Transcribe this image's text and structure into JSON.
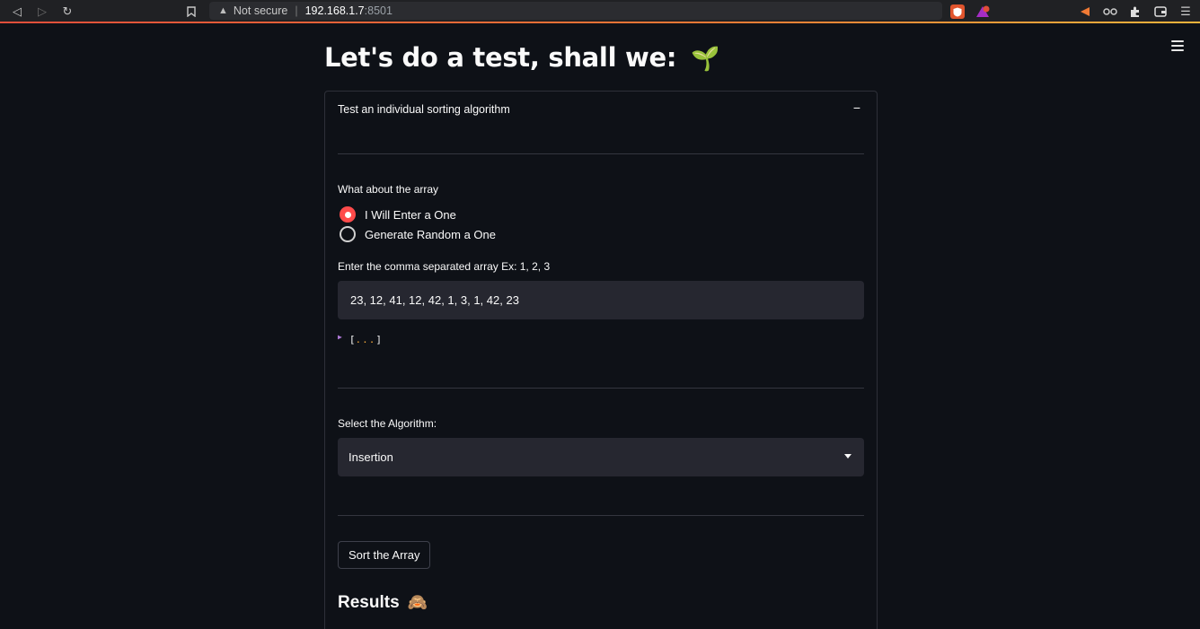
{
  "browser": {
    "security_label": "Not secure",
    "host": "192.168.1.7",
    "port": ":8501"
  },
  "page": {
    "title": "Let's do a test, shall we:",
    "title_emoji": "🌱"
  },
  "expander": {
    "header": "Test an individual sorting algorithm",
    "toggle": "−"
  },
  "array_section": {
    "label": "What about the array",
    "options": [
      {
        "label": "I Will Enter a One",
        "selected": true
      },
      {
        "label": "Generate Random a One",
        "selected": false
      }
    ],
    "input_label": "Enter the comma separated array Ex: 1, 2, 3",
    "input_value": "23, 12, 41, 12, 42, 1, 3, 1, 42, 23",
    "json_open": "[",
    "json_dots": "...",
    "json_close": "]"
  },
  "algorithm_section": {
    "label": "Select the Algorithm:",
    "selected": "Insertion"
  },
  "actions": {
    "sort_button": "Sort the Array"
  },
  "results": {
    "heading": "Results",
    "emoji": "🙈"
  },
  "colors": {
    "accent": "#ff4b4b",
    "background": "#0e1117",
    "input_bg": "#262730"
  }
}
